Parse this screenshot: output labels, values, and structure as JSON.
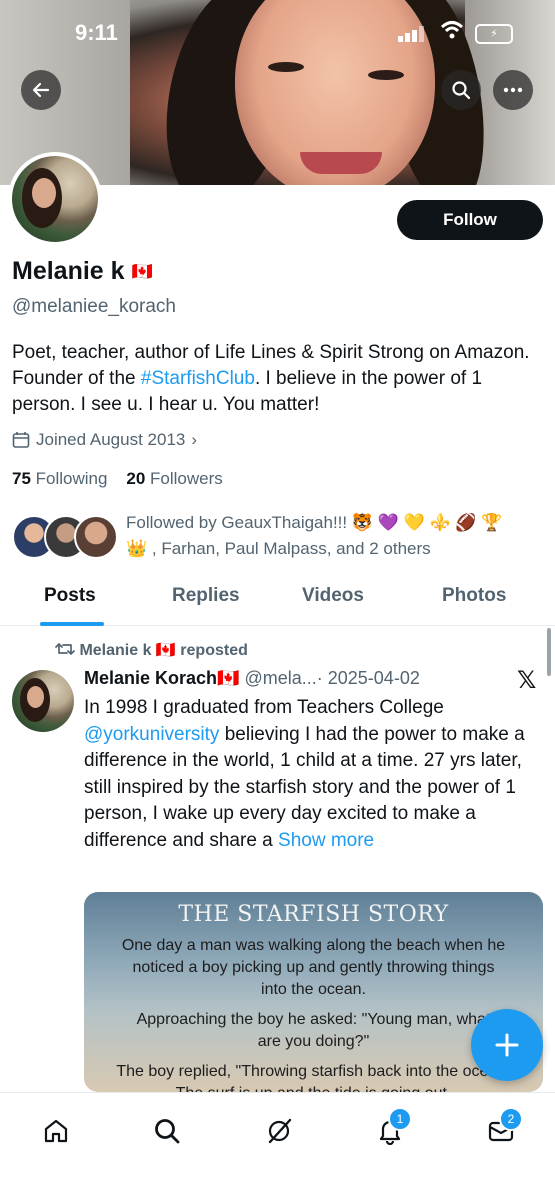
{
  "status_bar": {
    "time": "9:11"
  },
  "profile": {
    "name": "Melanie k",
    "flag": "🇨🇦",
    "handle": "@melaniee_korach",
    "follow_label": "Follow",
    "bio_part1": "Poet, teacher, author of Life Lines & Spirit Strong on Amazon. Founder of the ",
    "bio_hashtag": "#StarfishClub",
    "bio_part2": ". I believe in the power of 1 person. I see u. I hear u. You matter!",
    "joined": "Joined August 2013",
    "following_count": "75",
    "following_label": "Following",
    "followers_count": "20",
    "followers_label": "Followers",
    "followed_by_line1": "Followed by GeauxThaigah!!! 🐯 💜 💛 ⚜️ 🏈 🏆",
    "followed_by_line2": "👑 , Farhan, Paul Malpass, and 2 others"
  },
  "tabs": [
    "Posts",
    "Replies",
    "Videos",
    "Photos"
  ],
  "post": {
    "repost_label": "Melanie k 🇨🇦 reposted",
    "author": "Melanie Korach🇨🇦",
    "handle": "@mela...",
    "date": "· 2025-04-02",
    "text_part1": "In 1998 I graduated from Teachers College ",
    "mention": "@yorkuniversity",
    "text_part2": " believing I had the power to make a difference in the world, 1 child at a time. 27 yrs later, still inspired by the starfish story and the power of 1 person, I wake up every day excited to make a difference and share a ",
    "show_more": "Show more",
    "image": {
      "title": "THE STARFISH STORY",
      "line1": "One day a man was walking along the beach when he noticed a boy picking up and gently throwing things into the ocean.",
      "line2": "Approaching the boy he asked: \"Young man, what are you doing?\"",
      "line3": "The boy replied, \"Throwing starfish back into the ocean. The surf is up and the tide is going out."
    }
  },
  "nav": {
    "notifications_badge": "1",
    "messages_badge": "2"
  },
  "colors": {
    "accent": "#1d9bf0",
    "text": "#0f1419",
    "secondary": "#536471"
  }
}
